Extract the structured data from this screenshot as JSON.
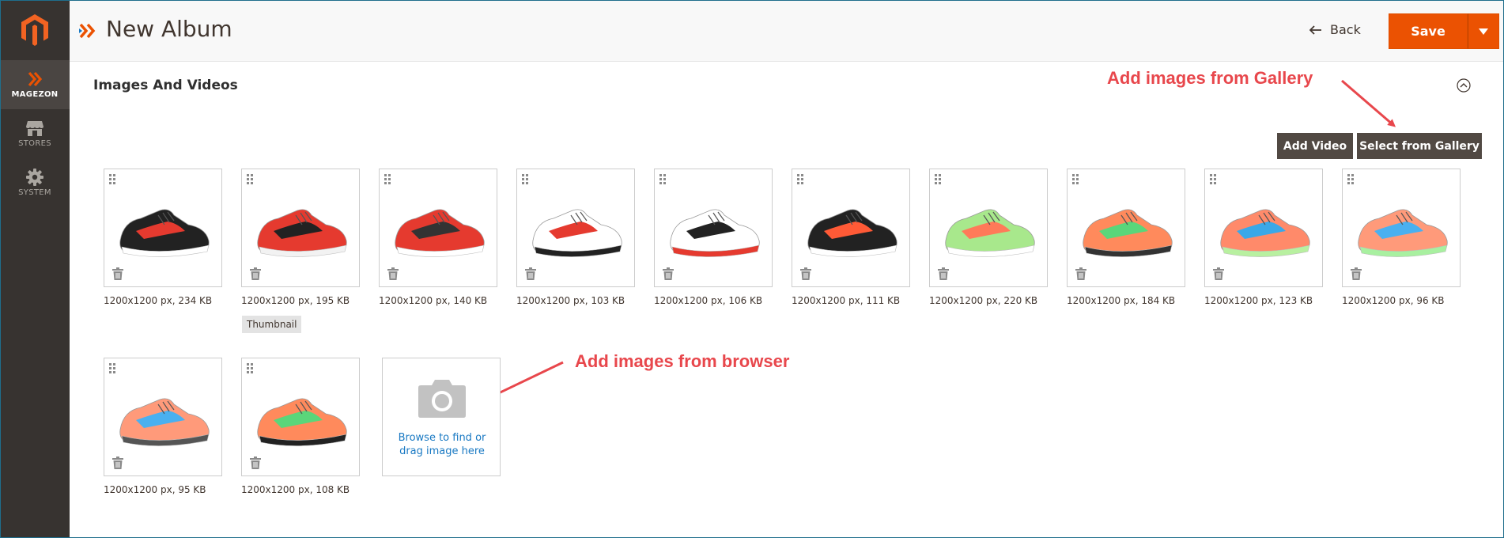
{
  "sidebar": {
    "items": [
      {
        "label": "MAGEZON",
        "icon": "magezon-icon",
        "active": true
      },
      {
        "label": "STORES",
        "icon": "store-icon",
        "active": false
      },
      {
        "label": "SYSTEM",
        "icon": "gear-icon",
        "active": false
      }
    ]
  },
  "header": {
    "title": "New Album",
    "back_label": "Back",
    "save_label": "Save"
  },
  "section": {
    "title": "Images And Videos",
    "add_video_label": "Add Video",
    "select_gallery_label": "Select from Gallery"
  },
  "annotations": {
    "gallery": "Add images from Gallery",
    "browser": "Add images from browser"
  },
  "images": [
    {
      "caption": "1200x1200 px, 234 KB",
      "role": ""
    },
    {
      "caption": "1200x1200 px, 195 KB",
      "role": "Thumbnail"
    },
    {
      "caption": "1200x1200 px, 140 KB",
      "role": ""
    },
    {
      "caption": "1200x1200 px, 103 KB",
      "role": ""
    },
    {
      "caption": "1200x1200 px, 106 KB",
      "role": ""
    },
    {
      "caption": "1200x1200 px, 111 KB",
      "role": ""
    },
    {
      "caption": "1200x1200 px, 220 KB",
      "role": ""
    },
    {
      "caption": "1200x1200 px, 184 KB",
      "role": ""
    },
    {
      "caption": "1200x1200 px, 123 KB",
      "role": ""
    },
    {
      "caption": "1200x1200 px, 96 KB",
      "role": ""
    },
    {
      "caption": "1200x1200 px, 95 KB",
      "role": ""
    },
    {
      "caption": "1200x1200 px, 108 KB",
      "role": ""
    }
  ],
  "upload": {
    "line1": "Browse to find or",
    "line2": "drag image here"
  },
  "colors": {
    "accent": "#eb5202",
    "sidebar": "#373330",
    "annotation": "#e8474c",
    "link": "#1979c3"
  }
}
